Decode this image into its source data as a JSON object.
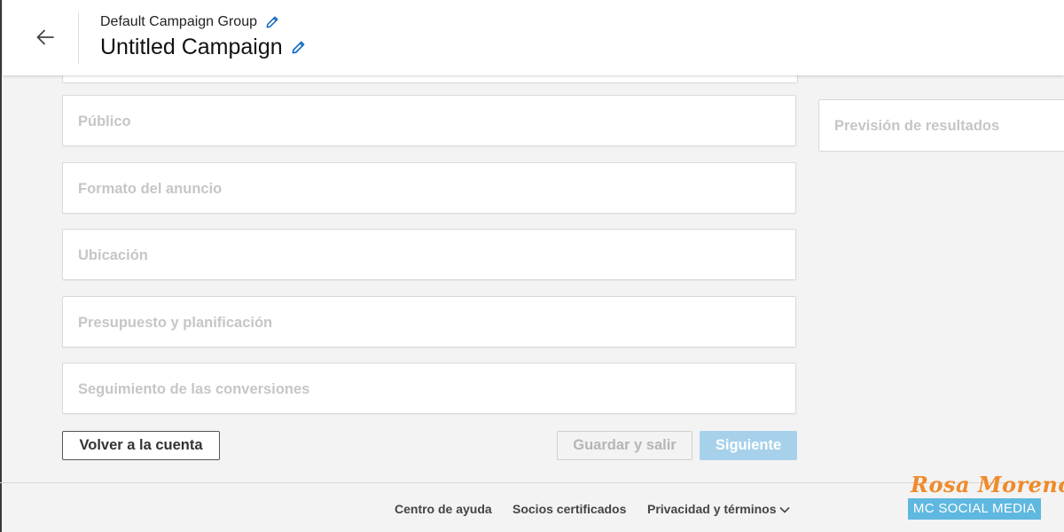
{
  "header": {
    "group_name": "Default Campaign Group",
    "campaign_name": "Untitled Campaign"
  },
  "sections": [
    {
      "label": "Público"
    },
    {
      "label": "Formato del anuncio"
    },
    {
      "label": "Ubicación"
    },
    {
      "label": "Presupuesto y planificación"
    },
    {
      "label": "Seguimiento de las conversiones"
    }
  ],
  "sidebar": {
    "forecast_label": "Previsión de resultados"
  },
  "actions": {
    "back_label": "Volver a la cuenta",
    "save_label": "Guardar y salir",
    "next_label": "Siguiente"
  },
  "footer": {
    "links": [
      {
        "label": "Centro de ayuda"
      },
      {
        "label": "Socios certificados"
      },
      {
        "label": "Privacidad y términos"
      }
    ]
  },
  "watermark": {
    "name": "Rosa Moreno",
    "brand": "MC SOCIAL MEDIA"
  },
  "colors": {
    "accent": "#0a66c2",
    "primary_disabled": "#a7d1eb",
    "placeholder_text": "#c6c6c6",
    "watermark_orange": "#f08a2a",
    "watermark_blue": "#5fb8e0"
  },
  "icons": {
    "back": "arrow-left-icon",
    "edit": "pencil-icon",
    "dropdown": "chevron-down-icon"
  }
}
